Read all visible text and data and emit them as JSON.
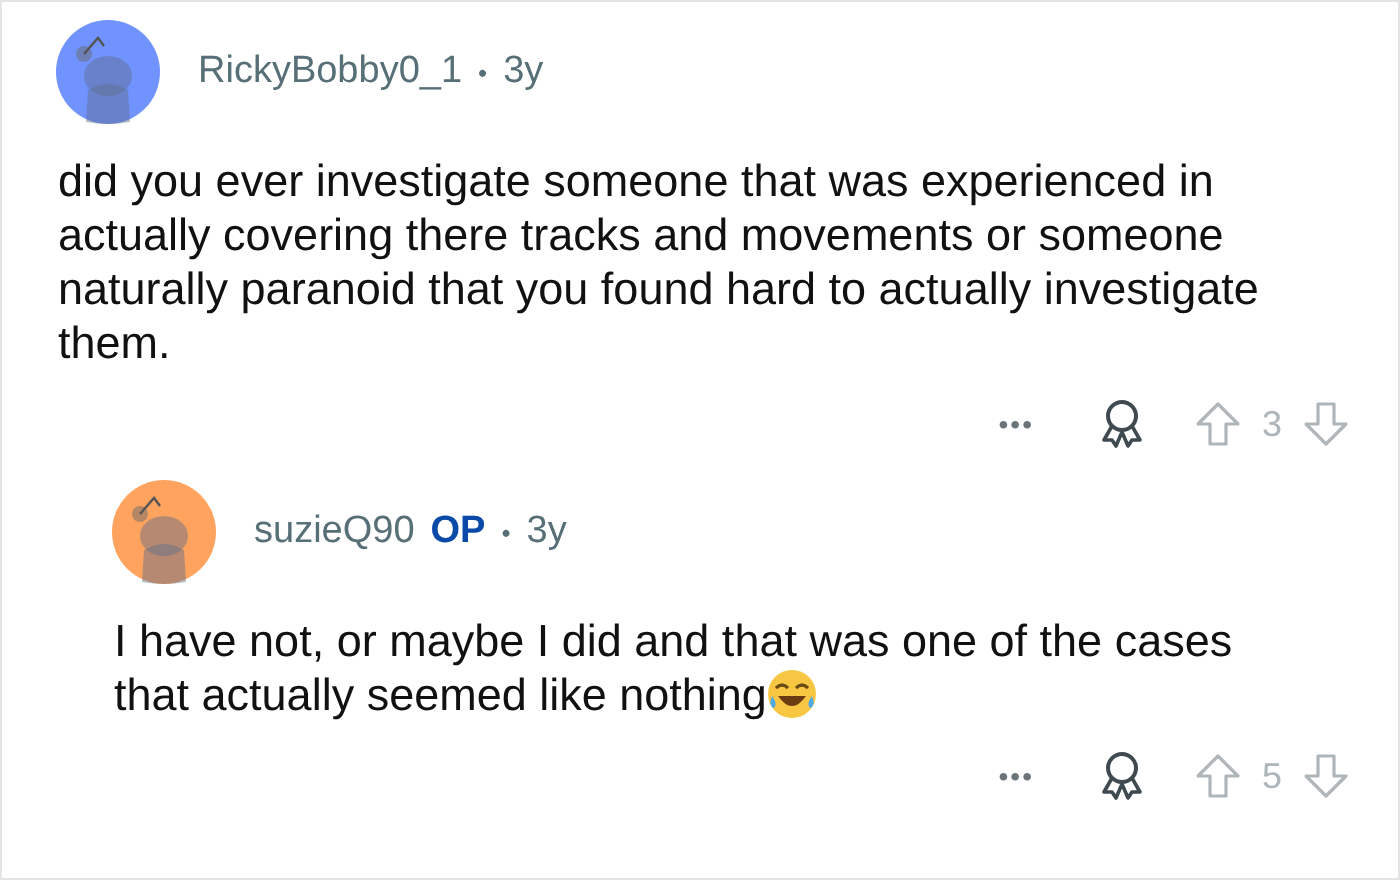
{
  "comments": [
    {
      "author": "RickyBobby0_1",
      "separator": "•",
      "age": "3y",
      "color": "#7193ff",
      "body": "did you ever investigate someone that was experienced in actually covering there tracks and movements or someone naturally paranoid that you found hard to actually investigate them.",
      "emoji": false,
      "more": "•••",
      "score": "3",
      "nested": false
    },
    {
      "author": "suzieQ90",
      "op_badge": "OP",
      "separator": "•",
      "age": "3y",
      "color": "#ffa35f",
      "body": "I have not, or maybe I did and that was one of the cases that actually seemed like nothing",
      "emoji": true,
      "more": "•••",
      "score": "5",
      "nested": true
    }
  ]
}
